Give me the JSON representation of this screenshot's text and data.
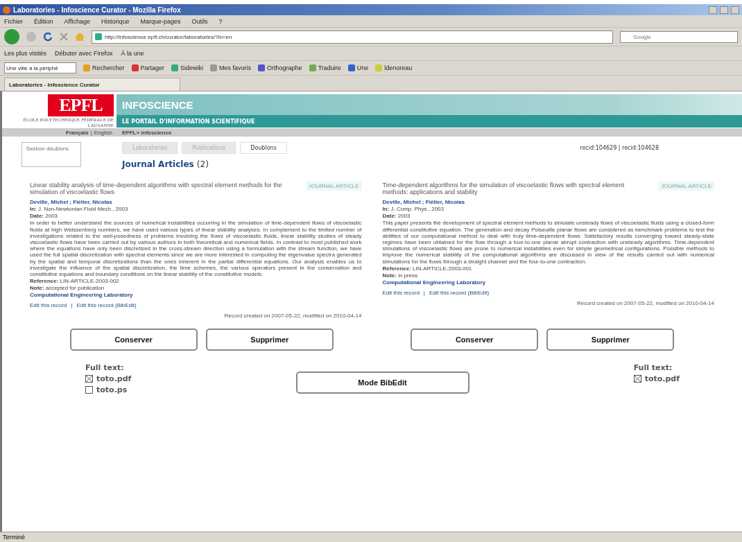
{
  "window": {
    "title": "Laboratories - Infoscience Curator - Mozilla Firefox"
  },
  "menu": [
    "Fichier",
    "Édition",
    "Affichage",
    "Historique",
    "Marque-pages",
    "Outils",
    "?"
  ],
  "address_bar": {
    "url": "http://infoscience.epfl.ch/curator/laboratories/?ln=en"
  },
  "search": {
    "placeholder": "Google"
  },
  "bookmarks": [
    "Les plus visités",
    "Débuter avec Firefox",
    "À la une"
  ],
  "google_toolbar": {
    "query": "Une ville à la périphé",
    "items": [
      "Rechercher",
      "Partager",
      "Sidewiki",
      "Mes favoris",
      "Orthographe",
      "Traduire",
      "Une",
      "ldenoreau"
    ]
  },
  "browser_tabs": [
    {
      "label": "Laboratories - Infoscience Curator",
      "selected": true
    }
  ],
  "page": {
    "logo": "EPFL",
    "school": "ÉCOLE POLYTECHNIQUE FÉDÉRALE DE LAUSANNE",
    "site_title": "INFOSCIENCE",
    "subtitle": "LE PORTAIL D'INFORMATION SCIENTIFIQUE",
    "languages": [
      {
        "label": "Français",
        "selected": true
      },
      {
        "label": "English",
        "selected": false
      }
    ],
    "language_separator": "|",
    "breadcrumb": "EPFL> infoscience",
    "side_box": "Gestion doublons",
    "tabs": [
      {
        "label": "Laboratories",
        "selected": false
      },
      {
        "label": "Publications",
        "selected": false
      },
      {
        "label": "Doublons",
        "selected": true
      }
    ],
    "recids": "recid:104629 | recid:104628",
    "heading": "Journal Articles",
    "count": "(2)",
    "records": [
      {
        "title": "Linear stability analysis of time-dependent algorithms with spectral element methods for the simulation of viscoelastic flows",
        "badge": "JOURNAL ARTICLE",
        "authors": "Deville, Michel ; Fiétier, Nicolas",
        "in": "**In:** J. Non-Newtonian Fluid Mech., 2003",
        "date": "**Date:** 2003",
        "abstract": "In order to better understand the sources of numerical instabilities occurring in the simulation of time-dependent flows of viscoelastic fluids at high Weissenberg numbers, we have used various types of linear stability analyses. In complement to the limited number of investigations related to the well-posedness of problems involving the flows of viscoelastic fluids, linear stability studies of steady viscoelastic flows have been carried out by various authors in both theoretical and numerical fields. In contrast to most published work where the equations have only been discretized in the cross-stream direction using a formulation with the stream function, we have used the full spatial discretization with spectral elements since we are more interested in computing the eigenvalue spectra generated by the spatial and temporal discretizations than the ones inherent in the partial differential equations. Our analysis enables us to investigate the influence of the spatial discretization, the time schemes, the various operators present in the conservation and constitutive equations and boundary conditions on the linear stability of the constitutive models.",
        "reference": "**Reference:** LIN-ARTICLE-2003-002",
        "note": "**Note:** accepted for publication",
        "lab": "Computational Engineering Laboratory",
        "edit_links": [
          "Edit this record",
          "Edit this record (BibEdit)"
        ],
        "link_separator": "|",
        "footer": "Record created on 2007-05-22, modified on 2010-04-14",
        "buttons": [
          "Conserver",
          "Supprimer"
        ],
        "full_text_label": "Full text:",
        "files": [
          {
            "name": "toto.pdf",
            "checked": true
          },
          {
            "name": "toto.ps",
            "checked": false
          }
        ]
      },
      {
        "title": "Time-dependent algorithms for the simulation of viscoelastic flows with spectral element methods: applications and stability",
        "badge": "JOURNAL ARTICLE",
        "authors": "Deville, Michel ; Fiétier, Nicolas",
        "in": "**In:** J. Comp. Phys., 2003",
        "date": "**Date:** 2003",
        "abstract": "This paper presents the development of spectral element methods to simulate unsteady flows of viscoelastic fluids using a closed-form differential constitutive equation. The generation and decay Poiseuille planar flows are considered as benchmark problems to test the abilities of our computational method to deal with truly time-dependent flows. Satisfactory results converging toward steady-state regimes have been obtained for the flow through a four-to-one planar abrupt contraction with unsteady algorithms. Time-dependent simulations of viscoelastic flows are prone to numerical instabilities even for simple geometrical configurations. Possible methods to improve the numerical stability of the computational algorithms are discussed in view of the results carried out with numerical simulations for the flows through a straight channel and the four-to-one contraction.",
        "reference": "**Reference:** LIN-ARTICLE-2003-001",
        "note": "**Note:** in press",
        "lab": "Computational Engineering Laboratory",
        "edit_links": [
          "Edit this record",
          "Edit this record (BibEdit)"
        ],
        "link_separator": "|",
        "footer": "Record created on 2007-05-22, modified on 2010-04-14",
        "buttons": [
          "Conserver",
          "Supprimer"
        ],
        "full_text_label": "Full text:",
        "files": [
          {
            "name": "toto.pdf",
            "checked": true
          }
        ]
      }
    ],
    "mode_button": "Mode BibEdit"
  },
  "status_bar": "Terminé"
}
